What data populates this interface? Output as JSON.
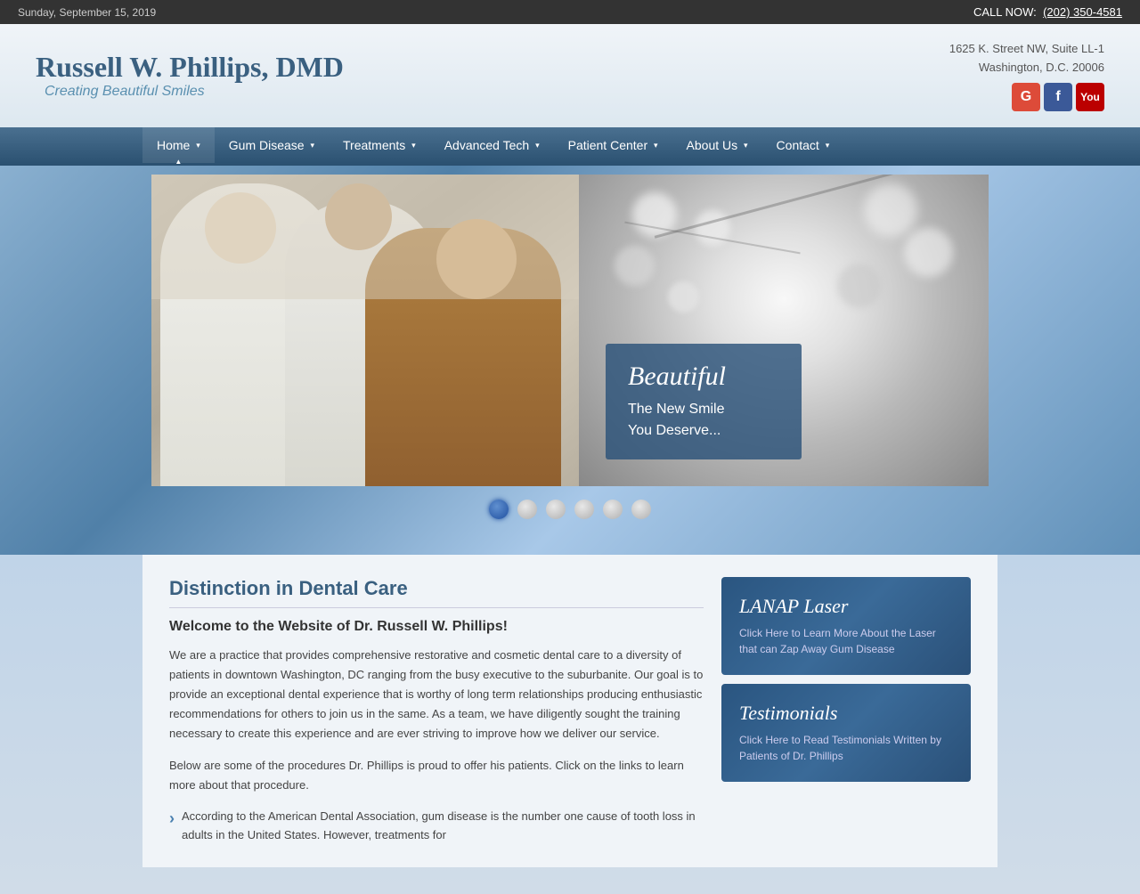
{
  "topbar": {
    "date": "Sunday, September 15, 2019",
    "call_label": "CALL NOW:",
    "phone": "(202) 350-4581"
  },
  "header": {
    "title": "Russell W. Phillips, DMD",
    "subtitle": "Creating Beautiful Smiles",
    "address_line1": "1625 K. Street NW, Suite LL-1",
    "address_line2": "Washington, D.C. 20006",
    "social": {
      "google_label": "G",
      "facebook_label": "f",
      "youtube_label": "You"
    }
  },
  "nav": {
    "items": [
      {
        "label": "Home",
        "has_dropdown": true
      },
      {
        "label": "Gum Disease",
        "has_dropdown": true
      },
      {
        "label": "Treatments",
        "has_dropdown": true
      },
      {
        "label": "Advanced Tech",
        "has_dropdown": true
      },
      {
        "label": "Patient Center",
        "has_dropdown": true
      },
      {
        "label": "About Us",
        "has_dropdown": true
      },
      {
        "label": "Contact",
        "has_dropdown": true
      }
    ]
  },
  "hero": {
    "overlay_title": "Beautiful",
    "overlay_subtitle": "The New Smile\nYou Deserve..."
  },
  "slides": {
    "total": 6,
    "active": 0
  },
  "content": {
    "heading": "Distinction in Dental Care",
    "welcome": "Welcome to the Website of Dr. Russell W. Phillips!",
    "paragraph1": "We are a practice that provides comprehensive restorative and cosmetic dental care to a diversity of patients in downtown Washington, DC ranging from the busy executive to the suburbanite. Our goal is to provide an exceptional dental experience that is worthy of long term relationships producing enthusiastic recommendations for others to join us in the same. As a team, we have diligently sought the training necessary to create this experience and are ever striving to improve how we deliver our service.",
    "paragraph2": "Below are some of the procedures Dr. Phillips is proud to offer his patients. Click on the links to learn more about that procedure.",
    "list_item": "According to the American Dental Association, gum disease is the number one cause of tooth loss in adults in the United States. However, treatments for"
  },
  "sidebar": {
    "cards": [
      {
        "title": "LANAP Laser",
        "desc": "Click Here to Learn More About the Laser that can Zap Away Gum Disease"
      },
      {
        "title": "Testimonials",
        "desc": "Click Here to Read Testimonials Written by Patients of Dr. Phillips"
      }
    ]
  }
}
